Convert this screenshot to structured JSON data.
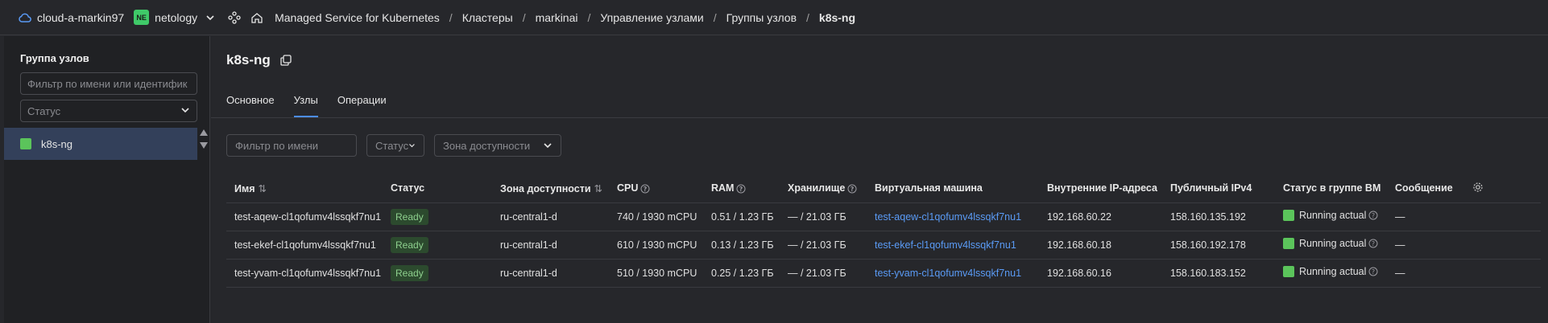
{
  "topbar": {
    "cloud": "cloud-a-markin97",
    "org_badge": "NE",
    "org": "netology",
    "breadcrumbs": [
      "Managed Service for Kubernetes",
      "Кластеры",
      "markinai",
      "Управление узлами",
      "Группы узлов"
    ],
    "current": "k8s-ng"
  },
  "sidebar": {
    "title": "Группа узлов",
    "filter_placeholder": "Фильтр по имени или идентифик",
    "status_placeholder": "Статус",
    "items": [
      {
        "label": "k8s-ng",
        "color": "#5bc45b"
      }
    ]
  },
  "main": {
    "title": "k8s-ng",
    "tabs": [
      {
        "label": "Основное",
        "active": false
      },
      {
        "label": "Узлы",
        "active": true
      },
      {
        "label": "Операции",
        "active": false
      }
    ],
    "filters": {
      "name_placeholder": "Фильтр по имени",
      "status": "Статус",
      "zone": "Зона доступности"
    }
  },
  "table": {
    "columns": [
      "Имя",
      "Статус",
      "Зона доступности",
      "CPU",
      "RAM",
      "Хранилище",
      "Виртуальная машина",
      "Внутренние IP-адреса",
      "Публичный IPv4",
      "Статус в группе ВМ",
      "Сообщение"
    ],
    "rows": [
      {
        "name": "test-aqew-cl1qofumv4lssqkf7nu1",
        "status": "Ready",
        "zone": "ru-central1-d",
        "cpu": "740 / 1930 mCPU",
        "ram": "0.51 / 1.23 ГБ",
        "storage": "— / 21.03 ГБ",
        "vm": "test-aqew-cl1qofumv4lssqkf7nu1",
        "internal_ip": "192.168.60.22",
        "public_ip": "158.160.135.192",
        "vm_status": "Running actual",
        "message": "—"
      },
      {
        "name": "test-ekef-cl1qofumv4lssqkf7nu1",
        "status": "Ready",
        "zone": "ru-central1-d",
        "cpu": "610 / 1930 mCPU",
        "ram": "0.13 / 1.23 ГБ",
        "storage": "— / 21.03 ГБ",
        "vm": "test-ekef-cl1qofumv4lssqkf7nu1",
        "internal_ip": "192.168.60.18",
        "public_ip": "158.160.192.178",
        "vm_status": "Running actual",
        "message": "—"
      },
      {
        "name": "test-yvam-cl1qofumv4lssqkf7nu1",
        "status": "Ready",
        "zone": "ru-central1-d",
        "cpu": "510 / 1930 mCPU",
        "ram": "0.25 / 1.23 ГБ",
        "storage": "— / 21.03 ГБ",
        "vm": "test-yvam-cl1qofumv4lssqkf7nu1",
        "internal_ip": "192.168.60.16",
        "public_ip": "158.160.183.152",
        "vm_status": "Running actual",
        "message": "—"
      }
    ]
  },
  "colors": {
    "accent": "#4c8df6",
    "ok": "#5bc45b",
    "link": "#5a9bf6"
  }
}
